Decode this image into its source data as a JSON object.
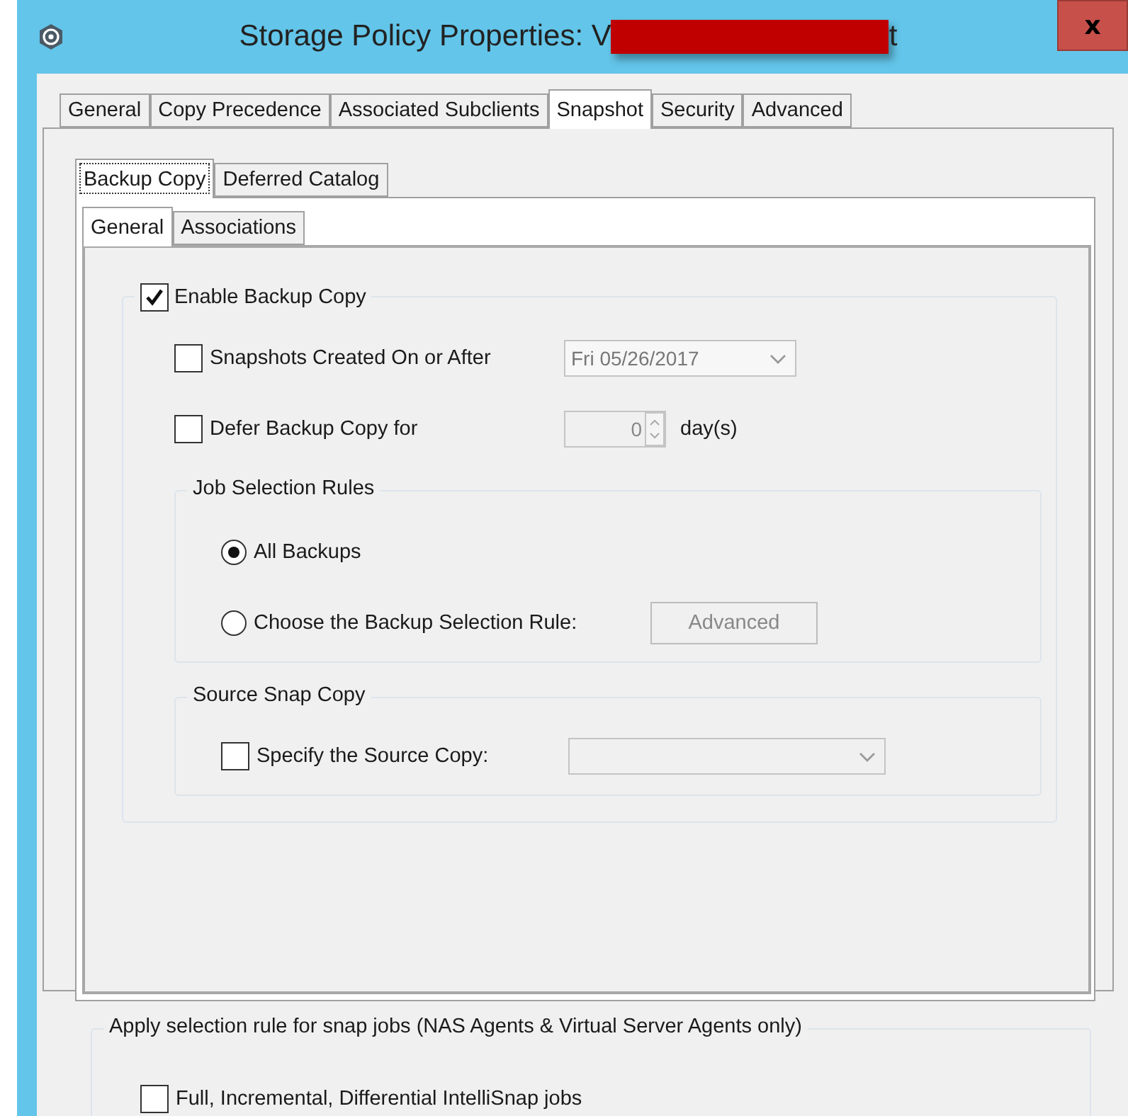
{
  "window": {
    "title_start": "Storage Policy Properties: V",
    "title_end": "t",
    "close": "x"
  },
  "tabs": [
    {
      "label": "General",
      "selected": false
    },
    {
      "label": "Copy Precedence",
      "selected": false
    },
    {
      "label": "Associated Subclients",
      "selected": false
    },
    {
      "label": "Snapshot",
      "selected": true
    },
    {
      "label": "Security",
      "selected": false
    },
    {
      "label": "Advanced",
      "selected": false
    }
  ],
  "sub_tabs": [
    {
      "label": "Backup Copy",
      "selected": true
    },
    {
      "label": "Deferred Catalog",
      "selected": false
    }
  ],
  "inner_tabs": [
    {
      "label": "General",
      "selected": true
    },
    {
      "label": "Associations",
      "selected": false
    }
  ],
  "enable_backup_copy": {
    "label": "Enable Backup Copy",
    "checked": true
  },
  "snapshots_after": {
    "label": "Snapshots Created On or After",
    "checked": false,
    "value": "Fri 05/26/2017"
  },
  "defer": {
    "label": "Defer Backup Copy for",
    "checked": false,
    "value": "0",
    "unit": "day(s)"
  },
  "job_selection": {
    "title": "Job Selection Rules",
    "options": [
      {
        "label": "All Backups",
        "selected": true
      },
      {
        "label": "Choose the Backup Selection Rule:",
        "selected": false
      }
    ],
    "button": "Advanced"
  },
  "source_snap": {
    "title": "Source Snap Copy",
    "label": "Specify the Source Copy:",
    "checked": false
  },
  "apply_rule": {
    "title": "Apply selection rule for snap jobs (NAS Agents & Virtual Server Agents only)",
    "label": "Full, Incremental, Differential IntelliSnap jobs",
    "checked": false
  }
}
